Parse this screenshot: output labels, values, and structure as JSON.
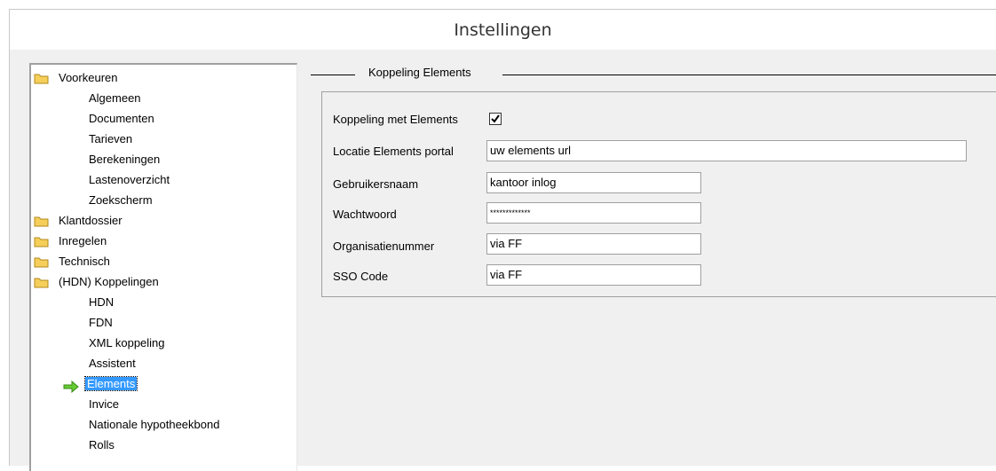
{
  "window": {
    "title": "Instellingen"
  },
  "tree": {
    "items": [
      {
        "label": "Voorkeuren",
        "type": "folder"
      },
      {
        "label": "Algemeen",
        "type": "leaf"
      },
      {
        "label": "Documenten",
        "type": "leaf"
      },
      {
        "label": "Tarieven",
        "type": "leaf"
      },
      {
        "label": "Berekeningen",
        "type": "leaf"
      },
      {
        "label": "Lastenoverzicht",
        "type": "leaf"
      },
      {
        "label": "Zoekscherm",
        "type": "leaf"
      },
      {
        "label": "Klantdossier",
        "type": "folder"
      },
      {
        "label": "Inregelen",
        "type": "folder"
      },
      {
        "label": "Technisch",
        "type": "folder"
      },
      {
        "label": "(HDN) Koppelingen",
        "type": "folder"
      },
      {
        "label": "HDN",
        "type": "leaf"
      },
      {
        "label": "FDN",
        "type": "leaf"
      },
      {
        "label": "XML koppeling",
        "type": "leaf"
      },
      {
        "label": "Assistent",
        "type": "leaf"
      },
      {
        "label": "Elements",
        "type": "leaf",
        "selected": true
      },
      {
        "label": "Invice",
        "type": "leaf"
      },
      {
        "label": "Nationale hypotheekbond",
        "type": "leaf"
      },
      {
        "label": "Rolls",
        "type": "leaf"
      }
    ]
  },
  "group": {
    "title": "Koppeling Elements"
  },
  "form": {
    "koppeling_label": "Koppeling met Elements",
    "koppeling_checked": true,
    "locatie_label": "Locatie Elements portal",
    "locatie_value": "uw elements url",
    "gebruiker_label": "Gebruikersnaam",
    "gebruiker_value": "kantoor inlog",
    "wachtwoord_label": "Wachtwoord",
    "wachtwoord_value": "*************",
    "org_label": "Organisatienummer",
    "org_value": "via FF",
    "sso_label": "SSO Code",
    "sso_value": "via FF"
  },
  "colors": {
    "selection": "#3399ff",
    "arrow": "#66cc33",
    "folder": "#f5cf5a"
  }
}
